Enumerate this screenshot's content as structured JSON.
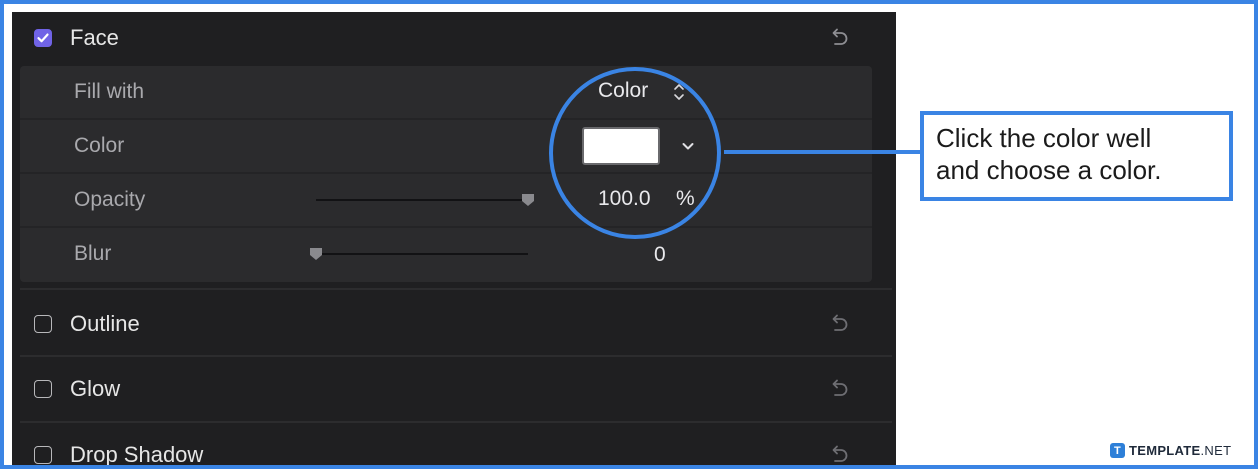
{
  "sections": {
    "face": {
      "label": "Face",
      "checked": true
    },
    "outline": {
      "label": "Outline",
      "checked": false
    },
    "glow": {
      "label": "Glow",
      "checked": false
    },
    "drop_shadow": {
      "label": "Drop Shadow",
      "checked": false
    }
  },
  "face_settings": {
    "fill_with": {
      "label": "Fill with",
      "value": "Color"
    },
    "color": {
      "label": "Color",
      "swatch": "#ffffff"
    },
    "opacity": {
      "label": "Opacity",
      "value": "100.0",
      "unit": "%",
      "level": 1.0
    },
    "blur": {
      "label": "Blur",
      "value": "0",
      "level": 0.0
    }
  },
  "callout": {
    "line1": "Click the color well",
    "line2": "and choose a color."
  },
  "brand": {
    "mark": "T",
    "name_bold": "TEMPLATE",
    "name_rest": ".NET"
  },
  "colors": {
    "accent": "#3a84e4",
    "checkbox_checked": "#7063e6",
    "panel_bg": "#1f1f21",
    "row_bg": "#2b2b2d"
  },
  "icons": {
    "reset": "reset-arrow-icon",
    "stepper": "up-down-chevron-icon",
    "dropdown": "chevron-down-icon",
    "check": "checkmark-icon"
  }
}
